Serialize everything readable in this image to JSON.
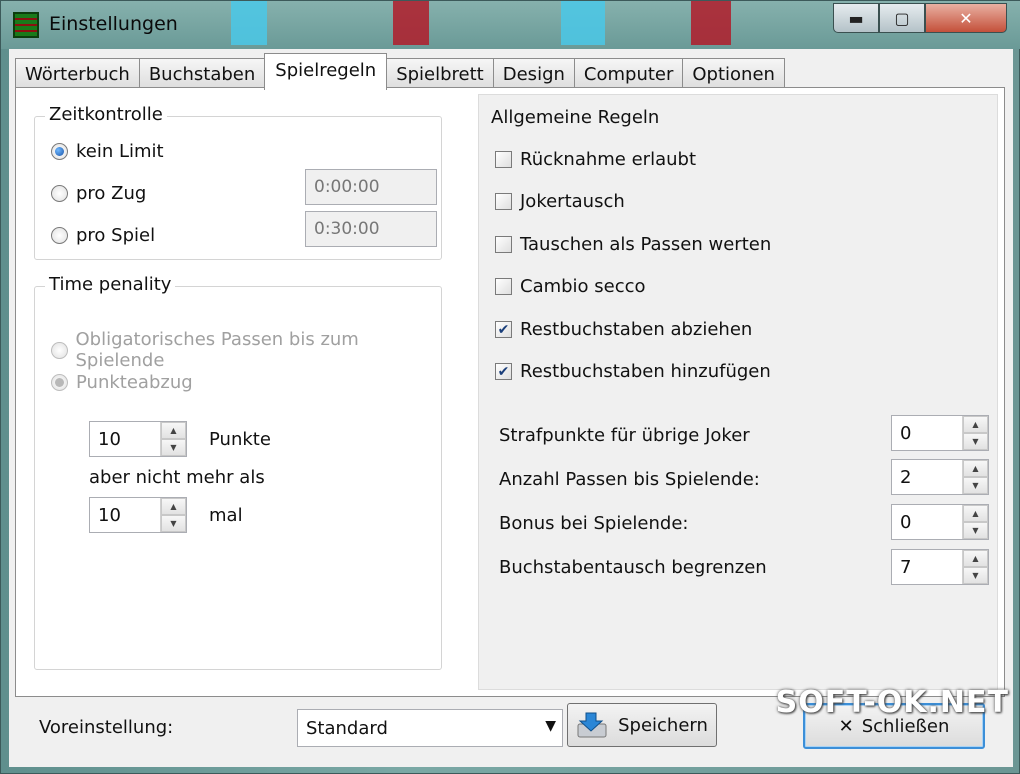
{
  "window": {
    "title": "Einstellungen",
    "controls": {
      "minimize": "▬",
      "maximize": "▢",
      "close": "✕"
    }
  },
  "tabs": [
    {
      "label": "Wörterbuch"
    },
    {
      "label": "Buchstaben"
    },
    {
      "label": "Spielregeln",
      "active": true
    },
    {
      "label": "Spielbrett"
    },
    {
      "label": "Design"
    },
    {
      "label": "Computer"
    },
    {
      "label": "Optionen"
    }
  ],
  "zeitkontrolle": {
    "legend": "Zeitkontrolle",
    "options": [
      {
        "label": "kein Limit",
        "checked": true
      },
      {
        "label": "pro Zug",
        "checked": false,
        "value": "0:00:00"
      },
      {
        "label": "pro Spiel",
        "checked": false,
        "value": "0:30:00"
      }
    ]
  },
  "time_penalty": {
    "legend": "Time penality",
    "options": [
      {
        "label": "Obligatorisches Passen bis zum Spielende",
        "checked": false,
        "disabled": true
      },
      {
        "label": "Punkteabzug",
        "checked": true,
        "disabled": true
      }
    ],
    "punkte_value": "10",
    "punkte_label": "Punkte",
    "max_label": "aber nicht mehr als",
    "mal_value": "10",
    "mal_label": "mal"
  },
  "allgemeine_regeln": {
    "legend": "Allgemeine Regeln",
    "checks": [
      {
        "label": "Rücknahme erlaubt",
        "checked": false
      },
      {
        "label": "Jokertausch",
        "checked": false
      },
      {
        "label": "Tauschen als Passen werten",
        "checked": false
      },
      {
        "label": "Cambio secco",
        "checked": false
      },
      {
        "label": "Restbuchstaben abziehen",
        "checked": true
      },
      {
        "label": "Restbuchstaben hinzufügen",
        "checked": true
      }
    ],
    "spinners": [
      {
        "label": "Strafpunkte für übrige Joker",
        "value": "0"
      },
      {
        "label": "Anzahl Passen bis Spielende:",
        "value": "2"
      },
      {
        "label": "Bonus bei Spielende:",
        "value": "0"
      },
      {
        "label": "Buchstabentausch begrenzen",
        "value": "7"
      }
    ]
  },
  "bottom": {
    "preset_label": "Voreinstellung:",
    "preset_value": "Standard",
    "save_label": "Speichern",
    "close_label": "Schließen"
  },
  "watermark": "SOFT-OK.NET",
  "glyphs": {
    "check": "✔",
    "up": "▲",
    "down": "▼",
    "dropdown": "▼",
    "close_x": "✕"
  }
}
